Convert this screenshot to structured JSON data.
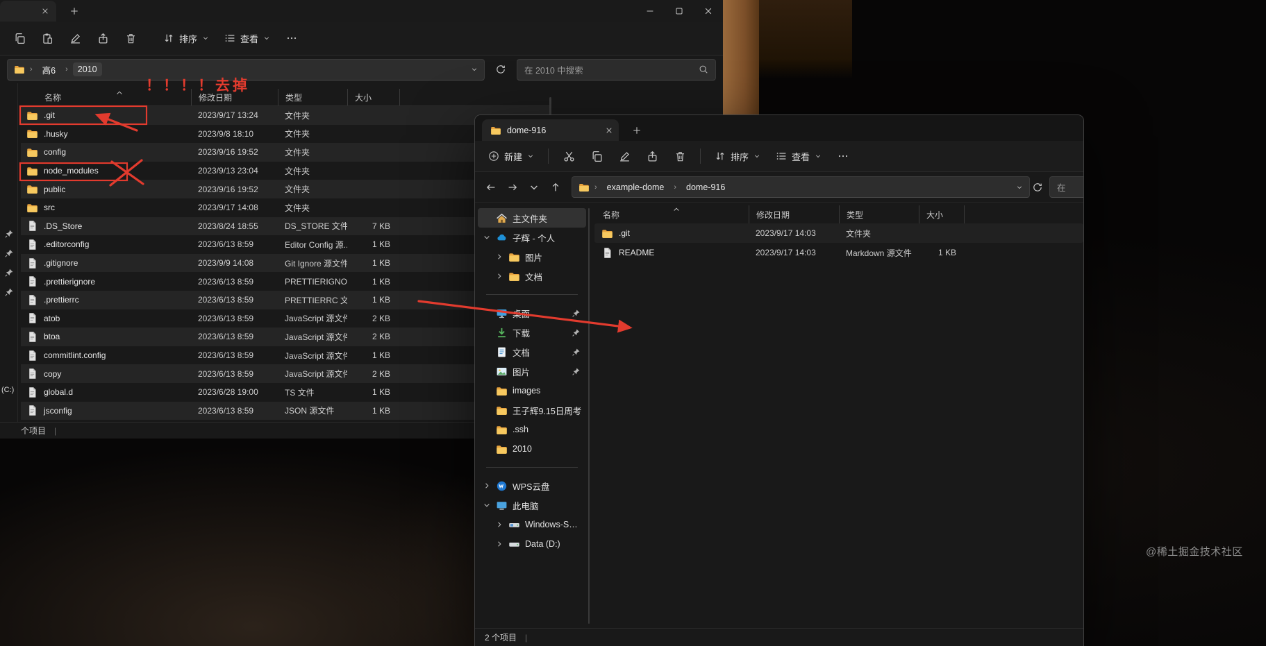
{
  "colors": {
    "annotation_red": "#e23b2e",
    "folder_yellow": "#f7c95f",
    "onedrive_blue": "#1e90d6",
    "selected_bg": "#323232",
    "window_bg": "#191919"
  },
  "desktop": {
    "watermark": "@稀土掘金技术社区"
  },
  "left_window": {
    "toolbar": {
      "icons": [
        "copy",
        "paste",
        "rename",
        "share",
        "delete"
      ],
      "sort_label": "排序",
      "view_label": "查看"
    },
    "address": {
      "crumbs": [
        "高6",
        "2010"
      ],
      "search_placeholder": "在 2010 中搜索"
    },
    "annotations": {
      "note": "！！！！去掉"
    },
    "list": {
      "columns": [
        "名称",
        "修改日期",
        "类型",
        "大小"
      ],
      "rows": [
        {
          "icon": "folder",
          "name": ".git",
          "date": "2023/9/17 13:24",
          "type": "文件夹",
          "size": ""
        },
        {
          "icon": "folder",
          "name": ".husky",
          "date": "2023/9/8 18:10",
          "type": "文件夹",
          "size": ""
        },
        {
          "icon": "folder",
          "name": "config",
          "date": "2023/9/16 19:52",
          "type": "文件夹",
          "size": ""
        },
        {
          "icon": "folder",
          "name": "node_modules",
          "date": "2023/9/13 23:04",
          "type": "文件夹",
          "size": ""
        },
        {
          "icon": "folder",
          "name": "public",
          "date": "2023/9/16 19:52",
          "type": "文件夹",
          "size": ""
        },
        {
          "icon": "folder",
          "name": "src",
          "date": "2023/9/17 14:08",
          "type": "文件夹",
          "size": ""
        },
        {
          "icon": "file",
          "name": ".DS_Store",
          "date": "2023/8/24 18:55",
          "type": "DS_STORE 文件",
          "size": "7 KB"
        },
        {
          "icon": "file",
          "name": ".editorconfig",
          "date": "2023/6/13 8:59",
          "type": "Editor Config 源...",
          "size": "1 KB"
        },
        {
          "icon": "file",
          "name": ".gitignore",
          "date": "2023/9/9 14:08",
          "type": "Git Ignore 源文件",
          "size": "1 KB"
        },
        {
          "icon": "file",
          "name": ".prettierignore",
          "date": "2023/6/13 8:59",
          "type": "PRETTIERIGNOR...",
          "size": "1 KB"
        },
        {
          "icon": "file",
          "name": ".prettierrc",
          "date": "2023/6/13 8:59",
          "type": "PRETTIERRC 文件",
          "size": "1 KB"
        },
        {
          "icon": "file",
          "name": "atob",
          "date": "2023/6/13 8:59",
          "type": "JavaScript 源文件",
          "size": "2 KB"
        },
        {
          "icon": "file",
          "name": "btoa",
          "date": "2023/6/13 8:59",
          "type": "JavaScript 源文件",
          "size": "2 KB"
        },
        {
          "icon": "file",
          "name": "commitlint.config",
          "date": "2023/6/13 8:59",
          "type": "JavaScript 源文件",
          "size": "1 KB"
        },
        {
          "icon": "file",
          "name": "copy",
          "date": "2023/6/13 8:59",
          "type": "JavaScript 源文件",
          "size": "2 KB"
        },
        {
          "icon": "file",
          "name": "global.d",
          "date": "2023/6/28 19:00",
          "type": "TS 文件",
          "size": "1 KB"
        },
        {
          "icon": "file",
          "name": "jsconfig",
          "date": "2023/6/13 8:59",
          "type": "JSON 源文件",
          "size": "1 KB"
        }
      ]
    },
    "strip": {
      "drive_label": "(C:)"
    },
    "statusbar": {
      "items_label": "个项目",
      "divider": "|"
    }
  },
  "right_window": {
    "tab": {
      "title": "dome-916"
    },
    "toolbar": {
      "new_label": "新建",
      "icons": [
        "cut",
        "copy",
        "rename",
        "share",
        "delete"
      ],
      "sort_label": "排序",
      "view_label": "查看"
    },
    "address": {
      "nav_icons": [
        "arrow-left",
        "arrow-right",
        "chevron-down",
        "arrow-up"
      ],
      "crumbs": [
        "example-dome",
        "dome-916"
      ],
      "search_fragment": "在"
    },
    "sidebar": {
      "items": [
        {
          "label": "主文件夹",
          "icon": "home",
          "selected": true
        },
        {
          "label": "子辉 - 个人",
          "icon": "onedrive",
          "chevron": "chevron-down"
        },
        {
          "label": "图片",
          "icon": "folder",
          "chevron": "chevron-right",
          "indent": 1
        },
        {
          "label": "文档",
          "icon": "folder",
          "chevron": "chevron-right",
          "indent": 1
        },
        {
          "divider": true
        },
        {
          "label": "桌面",
          "icon": "desktop",
          "pinned": true
        },
        {
          "label": "下载",
          "icon": "download",
          "pinned": true
        },
        {
          "label": "文档",
          "icon": "document",
          "pinned": true
        },
        {
          "label": "图片",
          "icon": "picture",
          "pinned": true
        },
        {
          "label": "images",
          "icon": "folder"
        },
        {
          "label": "王子辉9.15日周考",
          "icon": "folder"
        },
        {
          "label": ".ssh",
          "icon": "folder"
        },
        {
          "label": "2010",
          "icon": "folder"
        },
        {
          "divider": true
        },
        {
          "label": "WPS云盘",
          "icon": "wps",
          "chevron": "chevron-right"
        },
        {
          "label": "此电脑",
          "icon": "computer",
          "chevron": "chevron-down"
        },
        {
          "label": "Windows-SSD (C:)",
          "icon": "drive-windows",
          "chevron": "chevron-right",
          "indent": 1
        },
        {
          "label": "Data (D:)",
          "icon": "drive",
          "chevron": "chevron-right",
          "indent": 1
        }
      ]
    },
    "list": {
      "columns": [
        "名称",
        "修改日期",
        "类型",
        "大小"
      ],
      "rows": [
        {
          "icon": "folder",
          "name": ".git",
          "date": "2023/9/17 14:03",
          "type": "文件夹",
          "size": ""
        },
        {
          "icon": "file",
          "name": "README",
          "date": "2023/9/17 14:03",
          "type": "Markdown 源文件",
          "size": "1 KB"
        }
      ]
    },
    "statusbar": {
      "text": "2 个项目",
      "divider": "|"
    }
  }
}
